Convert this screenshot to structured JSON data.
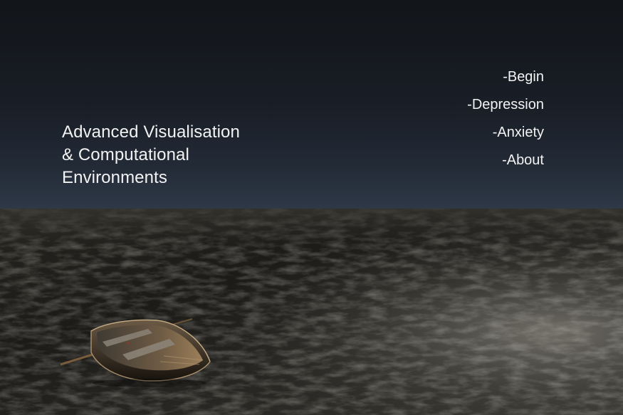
{
  "title": {
    "line1": "Advanced Visualisation",
    "line2": "& Computational",
    "line3": "Environments"
  },
  "menu": {
    "items": [
      {
        "label": "-Begin"
      },
      {
        "label": "-Depression"
      },
      {
        "label": "-Anxiety"
      },
      {
        "label": "-About"
      }
    ]
  },
  "colors": {
    "sky_top": "#121519",
    "sky_horizon": "#2e3846",
    "sea_dark": "#1a1a18",
    "sea_light": "#5c5b55",
    "text": "#f2f2f2"
  }
}
